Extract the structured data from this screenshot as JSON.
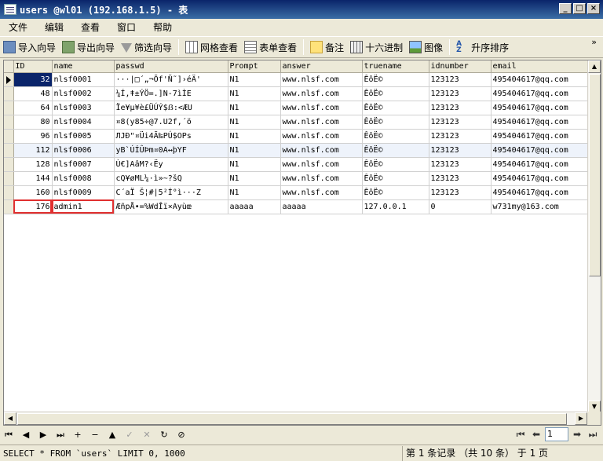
{
  "window": {
    "title": "users @wl01 (192.168.1.5) - 表"
  },
  "window_controls": {
    "minimize": "_",
    "maximize": "□",
    "close": "×"
  },
  "menu": [
    "文件",
    "编辑",
    "查看",
    "窗口",
    "帮助"
  ],
  "toolbar": {
    "import": "导入向导",
    "export": "导出向导",
    "filter": "筛选向导",
    "grid_view": "网格查看",
    "form_view": "表单查看",
    "note": "备注",
    "hex": "十六进制",
    "image": "图像",
    "sort": "升序排序",
    "sort_icon_top": "A",
    "sort_icon_bottom": "Z",
    "more": "»"
  },
  "table": {
    "columns": [
      "ID",
      "name",
      "passwd",
      "Prompt",
      "answer",
      "truename",
      "idnumber",
      "email"
    ],
    "rows": [
      [
        "32",
        "nlsf0001",
        "···|□´„¬Õf'Ñ˜]›éÄ'",
        "N1",
        "www.nlsf.com",
        "ÊôË©",
        "123123",
        "495404617@qq.com"
      ],
      [
        "48",
        "nlsf0002",
        "¼Í,ǂ±ÝÖ=.]N-7ìÌE",
        "N1",
        "www.nlsf.com",
        "ÊôË©",
        "123123",
        "495404617@qq.com"
      ],
      [
        "64",
        "nlsf0003",
        "Ïe¥µ¥è£ÜÚÝ$ẞ:<ÆU",
        "N1",
        "www.nlsf.com",
        "ÊôË©",
        "123123",
        "495404617@qq.com"
      ],
      [
        "80",
        "nlsf0004",
        "¤8(y85÷@7.U2f,´ö",
        "N1",
        "www.nlsf.com",
        "ÊôË©",
        "123123",
        "495404617@qq.com"
      ],
      [
        "96",
        "nlsf0005",
        "ЛJÐ\"¤Üi4Ã‰PÚ$OPs",
        "N1",
        "www.nlsf.com",
        "ÊôË©",
        "123123",
        "495404617@qq.com"
      ],
      [
        "112",
        "nlsf0006",
        "yB`ÚÍÛÞm¤0A↔þYF",
        "N1",
        "www.nlsf.com",
        "ÊôË©",
        "123123",
        "495404617@qq.com"
      ],
      [
        "128",
        "nlsf0007",
        "Ù€]AâM?‹Ëy",
        "N1",
        "www.nlsf.com",
        "ÊôË©",
        "123123",
        "495404617@qq.com"
      ],
      [
        "144",
        "nlsf0008",
        "cQ¥øML¼·ì»~?šQ",
        "N1",
        "www.nlsf.com",
        "ÊôË©",
        "123123",
        "495404617@qq.com"
      ],
      [
        "160",
        "nlsf0009",
        "C´aÏ Š¦#|5²Í°ì···Z",
        "N1",
        "www.nlsf.com",
        "ÊôË©",
        "123123",
        "495404617@qq.com"
      ],
      [
        "176",
        "admin1",
        "ÆñpÅ•=%WdÎï×Ayùœ",
        "aaaaa",
        "aaaaa",
        "127.0.0.1",
        "0",
        "w731my@163.com"
      ]
    ]
  },
  "navigation": {
    "first": "⏮",
    "prev": "◀",
    "next": "▶",
    "last": "⏭",
    "add": "+",
    "delete": "−",
    "up": "▲",
    "apply": "✓",
    "cancel": "✕",
    "refresh": "↻",
    "stop": "⊘",
    "page_first": "⏮",
    "page_prev": "⬅",
    "page_number": "1",
    "page_next": "➡",
    "page_last": "⏭"
  },
  "status": {
    "sql": "SELECT * FROM `users` LIMIT 0, 1000",
    "record_info": "第 1 条记录 （共 10 条） 于 1 页"
  },
  "scrollbar": {
    "up": "▲",
    "down": "▼",
    "left": "◀",
    "right": "▶"
  }
}
